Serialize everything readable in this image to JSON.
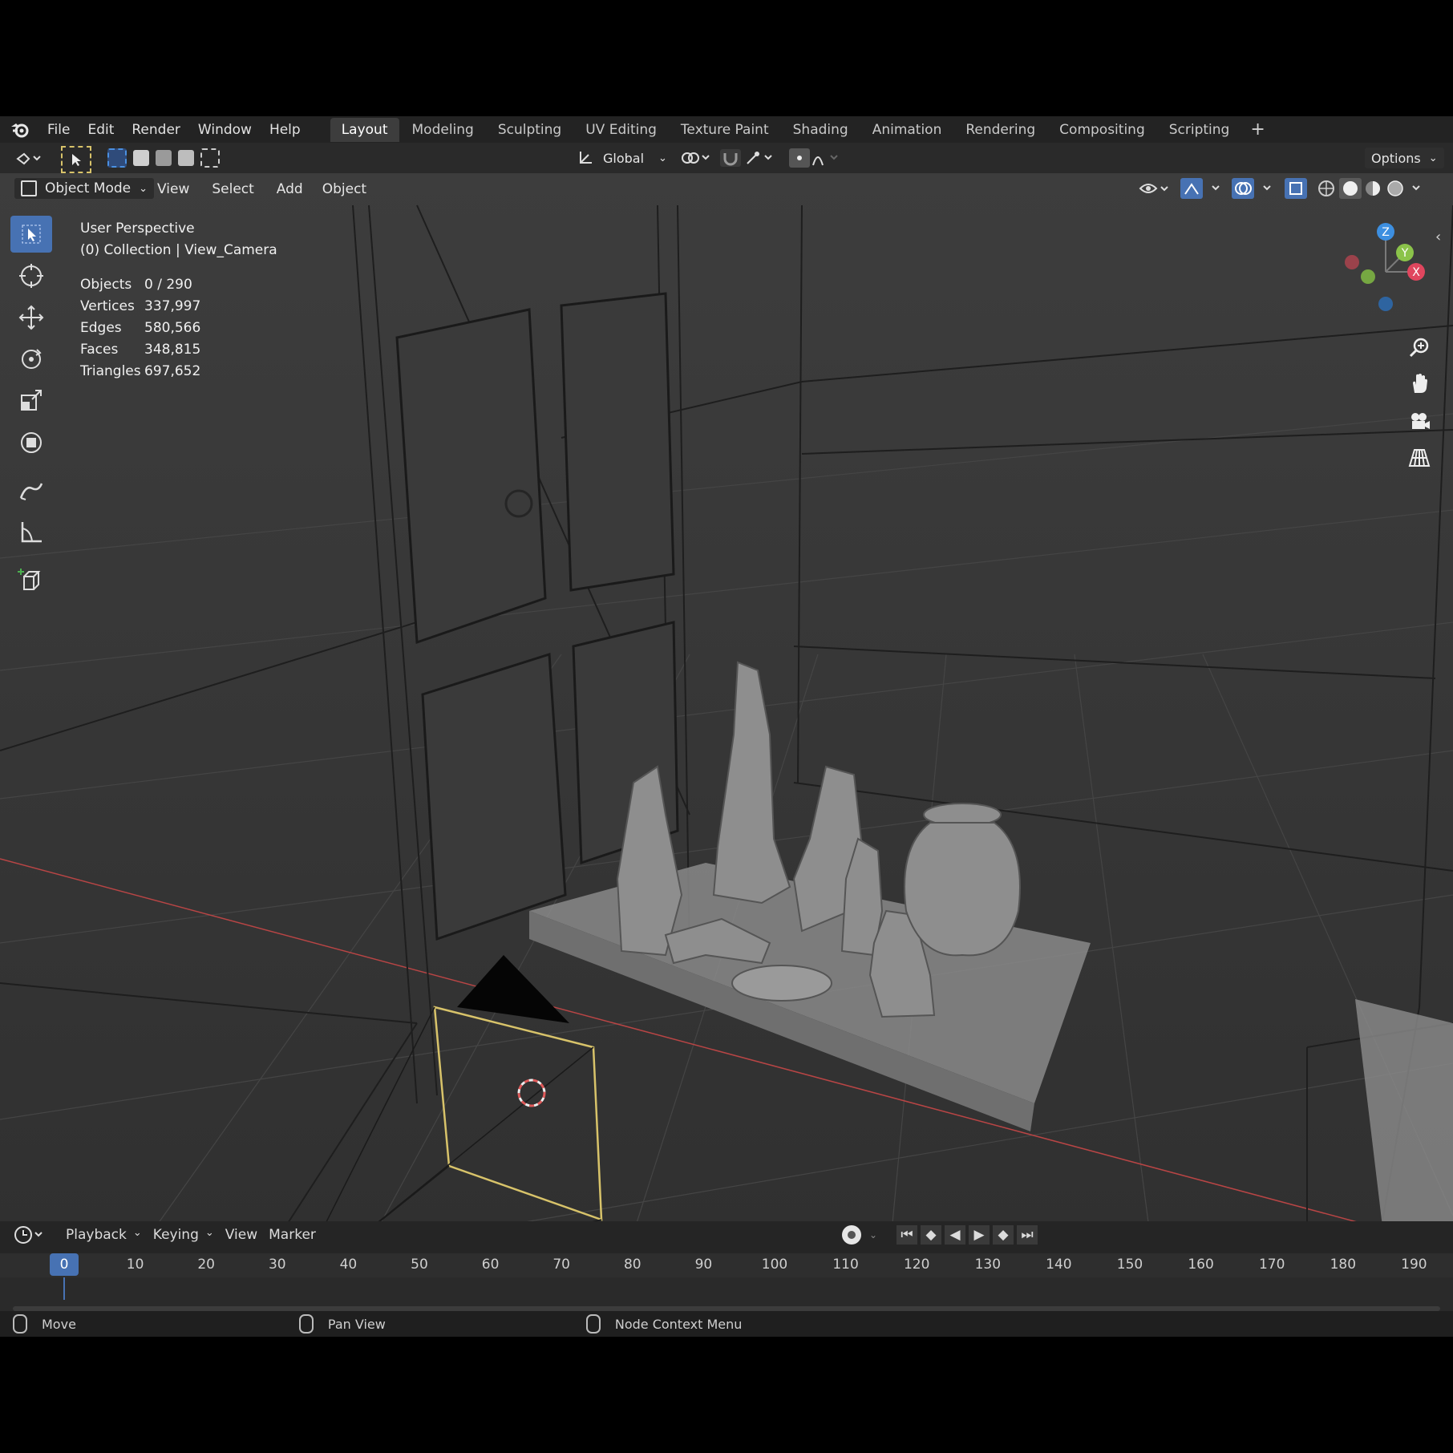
{
  "menu": [
    "File",
    "Edit",
    "Render",
    "Window",
    "Help"
  ],
  "workspaces": [
    {
      "label": "Layout",
      "active": true
    },
    {
      "label": "Modeling"
    },
    {
      "label": "Sculpting"
    },
    {
      "label": "UV Editing"
    },
    {
      "label": "Texture Paint"
    },
    {
      "label": "Shading"
    },
    {
      "label": "Animation"
    },
    {
      "label": "Rendering"
    },
    {
      "label": "Compositing"
    },
    {
      "label": "Scripting"
    }
  ],
  "toolheader": {
    "orientation": "Global",
    "options": "Options"
  },
  "viewport_header": {
    "mode": "Object Mode",
    "menus": [
      "View",
      "Select",
      "Add",
      "Object"
    ]
  },
  "hud": {
    "view": "User Perspective",
    "collection": "(0) Collection | View_Camera",
    "stats": [
      {
        "k": "Objects",
        "v": "0 / 290"
      },
      {
        "k": "Vertices",
        "v": "337,997"
      },
      {
        "k": "Edges",
        "v": "580,566"
      },
      {
        "k": "Faces",
        "v": "348,815"
      },
      {
        "k": "Triangles",
        "v": "697,652"
      }
    ]
  },
  "gizmo": {
    "z": "Z",
    "y": "Y",
    "x": "X",
    "colors": {
      "x": "#e0465e",
      "y": "#8bc34a",
      "z": "#3d8fe0"
    }
  },
  "timeline": {
    "menus": [
      "Playback",
      "Keying",
      "View",
      "Marker"
    ],
    "current_frame": "0",
    "ruler": [
      "0",
      "10",
      "20",
      "30",
      "40",
      "50",
      "60",
      "70",
      "80",
      "90",
      "100",
      "110",
      "120",
      "130",
      "140",
      "150",
      "160",
      "170",
      "180",
      "190"
    ]
  },
  "status": {
    "left": "Move",
    "middle": "Pan View",
    "right": "Node Context Menu"
  },
  "colors": {
    "accent": "#4772b3",
    "camera_select": "#d8c36a",
    "x_axis": "#b84545"
  }
}
